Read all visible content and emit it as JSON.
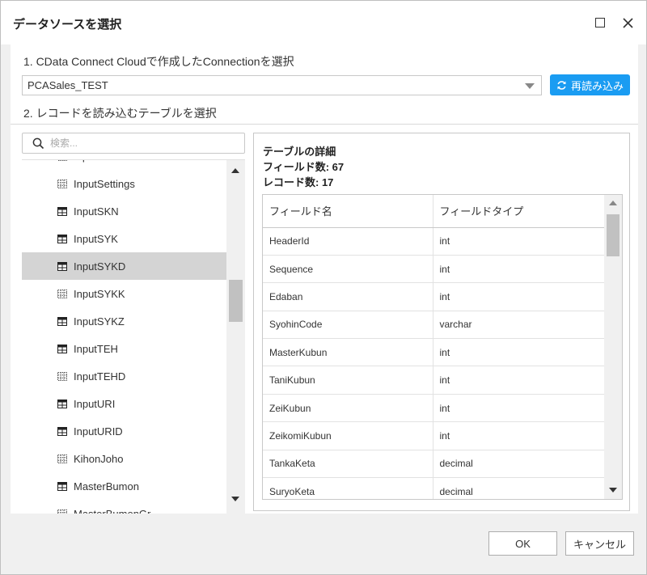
{
  "dialog": {
    "title": "データソースを選択",
    "step1_label": "1. CData Connect Cloudで作成したConnectionを選択",
    "connection_value": "PCASales_TEST",
    "reload_label": "再読み込み",
    "step2_label": "2. レコードを読み込むテーブルを選択",
    "search_placeholder": "検索...",
    "ok_label": "OK",
    "cancel_label": "キャンセル"
  },
  "table_list": {
    "items": [
      {
        "label": "Input",
        "type": "view"
      },
      {
        "label": "InputSettings",
        "type": "view"
      },
      {
        "label": "InputSKN",
        "type": "table"
      },
      {
        "label": "InputSYK",
        "type": "table"
      },
      {
        "label": "InputSYKD",
        "type": "table",
        "selected": true
      },
      {
        "label": "InputSYKK",
        "type": "view"
      },
      {
        "label": "InputSYKZ",
        "type": "table"
      },
      {
        "label": "InputTEH",
        "type": "table"
      },
      {
        "label": "InputTEHD",
        "type": "view"
      },
      {
        "label": "InputURI",
        "type": "table"
      },
      {
        "label": "InputURID",
        "type": "table"
      },
      {
        "label": "KihonJoho",
        "type": "view"
      },
      {
        "label": "MasterBumon",
        "type": "table"
      },
      {
        "label": "MasterBumonGr",
        "type": "view"
      }
    ]
  },
  "detail": {
    "heading": "テーブルの詳細",
    "field_count": "フィールド数: 67",
    "record_count": "レコード数: 17",
    "columns": [
      "フィールド名",
      "フィールドタイプ"
    ],
    "rows": [
      [
        "HeaderId",
        "int"
      ],
      [
        "Sequence",
        "int"
      ],
      [
        "Edaban",
        "int"
      ],
      [
        "SyohinCode",
        "varchar"
      ],
      [
        "MasterKubun",
        "int"
      ],
      [
        "TaniKubun",
        "int"
      ],
      [
        "ZeiKubun",
        "int"
      ],
      [
        "ZeikomiKubun",
        "int"
      ],
      [
        "TankaKeta",
        "decimal"
      ],
      [
        "SuryoKeta",
        "decimal"
      ]
    ]
  },
  "colors": {
    "accent": "#1a9cf2",
    "selected_row": "#d4d4d4"
  }
}
